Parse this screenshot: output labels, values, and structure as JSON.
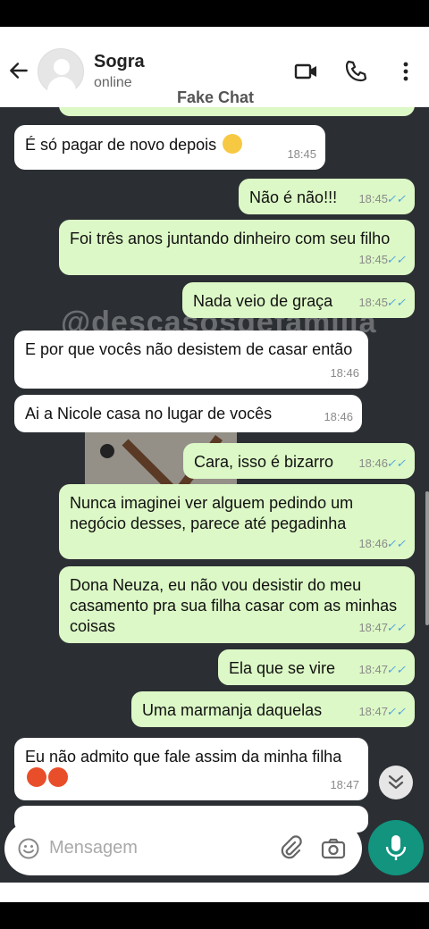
{
  "header": {
    "contact_name": "Sogra",
    "status": "online",
    "overlay_label": "Fake Chat"
  },
  "watermark": "@descasosdefamilia",
  "messages": [
    {
      "dir": "in",
      "text": "É só pagar de novo depois",
      "emoji": "eye-roll",
      "time": "18:45"
    },
    {
      "dir": "out",
      "text": "Não é não!!!",
      "time": "18:45",
      "read": true
    },
    {
      "dir": "out",
      "text": "Foi três anos juntando dinheiro com seu filho",
      "time": "18:45",
      "read": true
    },
    {
      "dir": "out",
      "text": "Nada veio de graça",
      "time": "18:45",
      "read": true
    },
    {
      "dir": "in",
      "text": "E por que vocês não desistem de casar então",
      "time": "18:46"
    },
    {
      "dir": "in",
      "text": "Ai a Nicole casa no lugar de vocês",
      "time": "18:46"
    },
    {
      "dir": "out",
      "text": "Cara, isso é bizarro",
      "time": "18:46",
      "read": true
    },
    {
      "dir": "out",
      "text": "Nunca imaginei ver alguem pedindo um negócio desses, parece até pegadinha",
      "time": "18:46",
      "read": true
    },
    {
      "dir": "out",
      "text": "Dona Neuza, eu não vou desistir do meu casamento pra sua filha casar com as minhas coisas",
      "time": "18:47",
      "read": true
    },
    {
      "dir": "out",
      "text": "Ela que se vire",
      "time": "18:47",
      "read": true
    },
    {
      "dir": "out",
      "text": "Uma marmanja daquelas",
      "time": "18:47",
      "read": true
    },
    {
      "dir": "in",
      "text": "Eu não admito que fale assim da minha filha",
      "emoji": "angry-angry",
      "time": "18:47"
    }
  ],
  "input": {
    "placeholder": "Mensagem"
  },
  "icons": {
    "back": "arrow-left-icon",
    "video": "video-camera-icon",
    "call": "phone-icon",
    "menu": "more-vertical-icon",
    "emoji": "smiley-icon",
    "attach": "paperclip-icon",
    "camera": "camera-icon",
    "mic": "microphone-icon",
    "scroll": "double-chevron-down-icon"
  },
  "colors": {
    "incoming_bubble": "#ffffff",
    "outgoing_bubble": "#dcf8c6",
    "chat_background": "#2b2f33",
    "read_ticks": "#4fa3e0",
    "mic_button": "#12947f"
  }
}
